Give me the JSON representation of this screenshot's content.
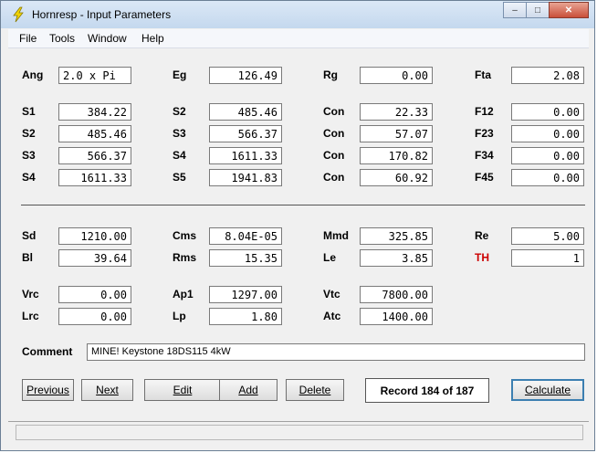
{
  "window": {
    "title": "Hornresp - Input Parameters",
    "min": "–",
    "max": "□",
    "close": "✕"
  },
  "menu": [
    "File",
    "Tools",
    "Window",
    "Help"
  ],
  "params": {
    "row0": [
      {
        "label": "Ang",
        "value": "2.0 x Pi",
        "align": "left"
      },
      {
        "label": "Eg",
        "value": "126.49"
      },
      {
        "label": "Rg",
        "value": "0.00"
      },
      {
        "label": "Fta",
        "value": "2.08"
      }
    ],
    "row1": [
      {
        "label": "S1",
        "value": "384.22"
      },
      {
        "label": "S2",
        "value": "485.46"
      },
      {
        "label": "Con",
        "value": "22.33"
      },
      {
        "label": "F12",
        "value": "0.00"
      }
    ],
    "row2": [
      {
        "label": "S2",
        "value": "485.46"
      },
      {
        "label": "S3",
        "value": "566.37"
      },
      {
        "label": "Con",
        "value": "57.07"
      },
      {
        "label": "F23",
        "value": "0.00"
      }
    ],
    "row3": [
      {
        "label": "S3",
        "value": "566.37"
      },
      {
        "label": "S4",
        "value": "1611.33"
      },
      {
        "label": "Con",
        "value": "170.82"
      },
      {
        "label": "F34",
        "value": "0.00"
      }
    ],
    "row4": [
      {
        "label": "S4",
        "value": "1611.33"
      },
      {
        "label": "S5",
        "value": "1941.83"
      },
      {
        "label": "Con",
        "value": "60.92"
      },
      {
        "label": "F45",
        "value": "0.00"
      }
    ],
    "row5": [
      {
        "label": "Sd",
        "value": "1210.00"
      },
      {
        "label": "Cms",
        "value": "8.04E-05"
      },
      {
        "label": "Mmd",
        "value": "325.85"
      },
      {
        "label": "Re",
        "value": "5.00"
      }
    ],
    "row6": [
      {
        "label": "Bl",
        "value": "39.64"
      },
      {
        "label": "Rms",
        "value": "15.35"
      },
      {
        "label": "Le",
        "value": "3.85"
      },
      {
        "label": "TH",
        "value": "1"
      }
    ],
    "row7": [
      {
        "label": "Vrc",
        "value": "0.00"
      },
      {
        "label": "Ap1",
        "value": "1297.00"
      },
      {
        "label": "Vtc",
        "value": "7800.00"
      }
    ],
    "row8": [
      {
        "label": "Lrc",
        "value": "0.00"
      },
      {
        "label": "Lp",
        "value": "1.80"
      },
      {
        "label": "Atc",
        "value": "1400.00"
      }
    ]
  },
  "comment": {
    "label": "Comment",
    "value": "MINE! Keystone 18DS115 4kW"
  },
  "buttons": {
    "previous": "Previous",
    "next": "Next",
    "edit": "Edit",
    "add": "Add",
    "delete": "Delete",
    "calculate": "Calculate"
  },
  "record": "Record 184 of 187",
  "colors": {
    "th_label": "#cc0000",
    "titlebar": "#c4d8ee"
  }
}
